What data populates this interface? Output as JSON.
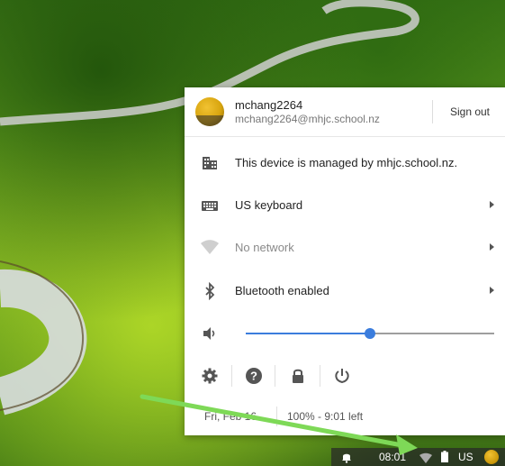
{
  "user": {
    "name": "mchang2264",
    "email": "mchang2264@mhjc.school.nz",
    "sign_out_label": "Sign out"
  },
  "rows": {
    "managed": {
      "label": "This device is managed by mhjc.school.nz.",
      "icon": "building-icon"
    },
    "keyboard": {
      "label": "US keyboard",
      "icon": "keyboard-icon"
    },
    "network": {
      "label": "No network",
      "icon": "wifi-icon"
    },
    "bluetooth": {
      "label": "Bluetooth enabled",
      "icon": "bluetooth-icon"
    }
  },
  "volume": {
    "level": 0.5,
    "icon": "speaker-icon"
  },
  "buttons": [
    "settings-icon",
    "help-icon",
    "lock-icon",
    "power-icon"
  ],
  "status": {
    "date": "Fri, Feb 16",
    "battery": "100% - 9:01 left"
  },
  "shelf": {
    "time": "08:01",
    "language": "US"
  },
  "colors": {
    "accent": "#3b7ddd",
    "annotation_arrow": "#7ed957"
  }
}
